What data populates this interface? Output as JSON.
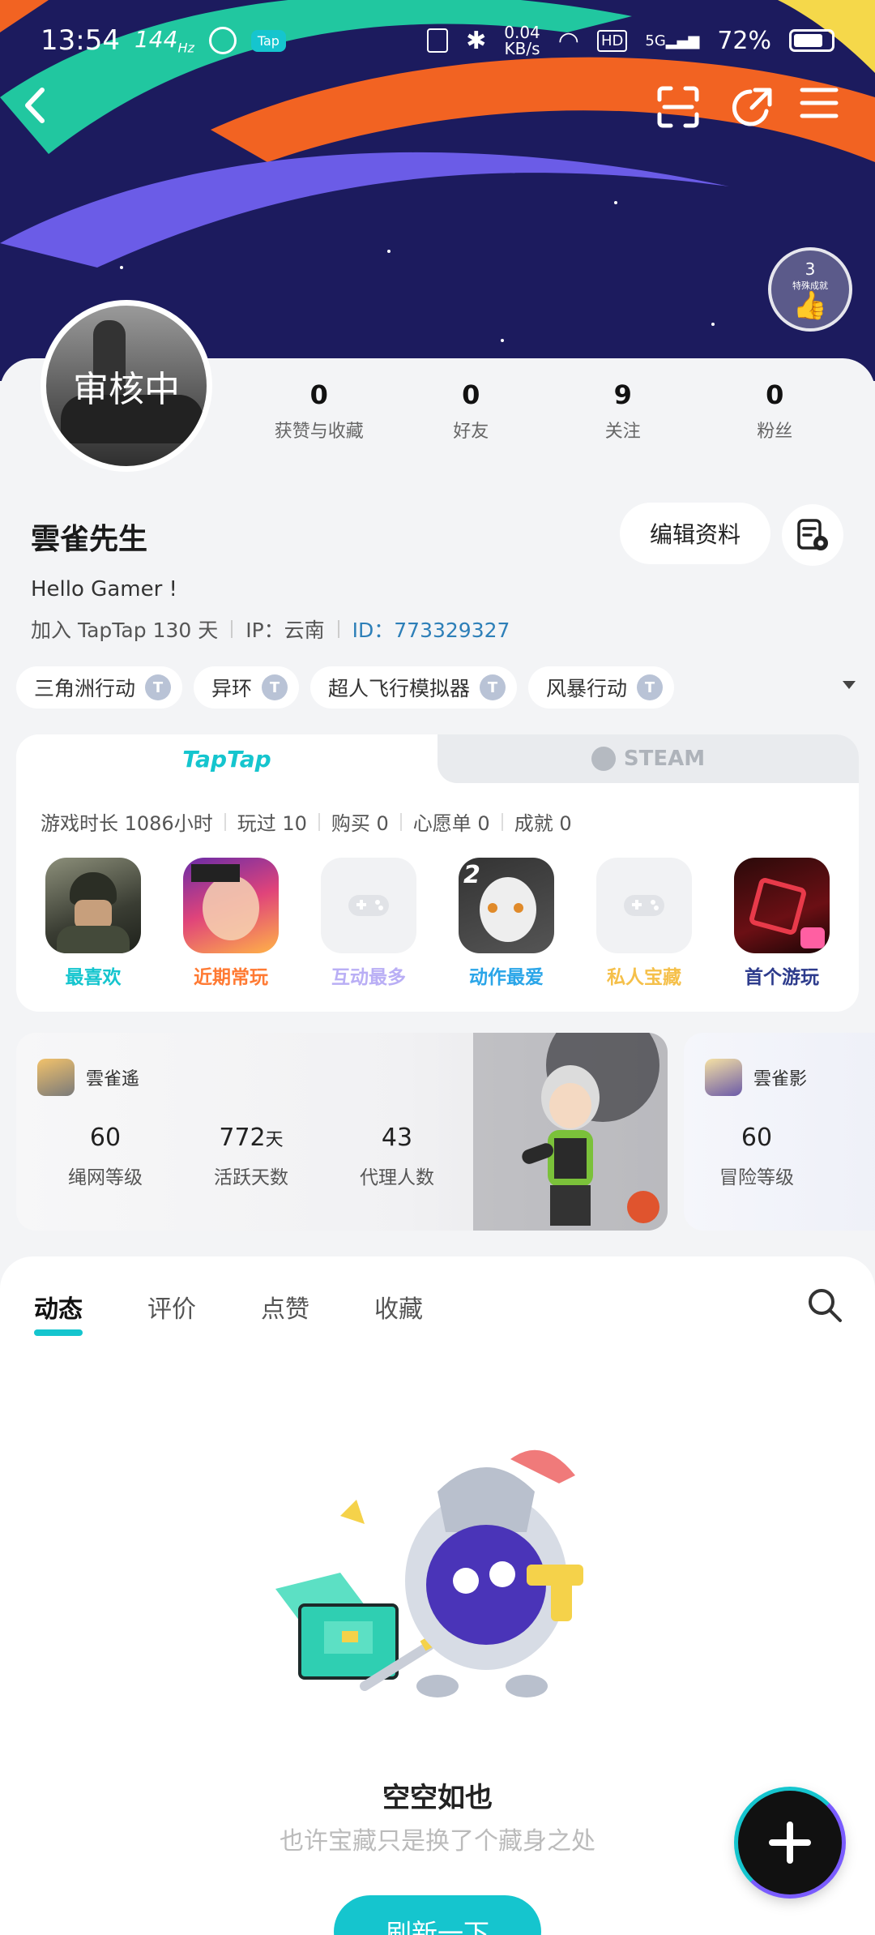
{
  "status_bar": {
    "time": "13:54",
    "refresh_rate": "144",
    "refresh_unit": "Hz",
    "app_badge": "Tap",
    "net_speed": "0.04",
    "net_unit": "KB/s",
    "hd": "HD",
    "signal": "5G",
    "battery": "72%"
  },
  "medal": {
    "count": "3",
    "label": "特殊成就"
  },
  "profile": {
    "avatar_text": "审核中",
    "stats": [
      {
        "value": "0",
        "label": "获赞与收藏"
      },
      {
        "value": "0",
        "label": "好友"
      },
      {
        "value": "9",
        "label": "关注"
      },
      {
        "value": "0",
        "label": "粉丝"
      }
    ],
    "username": "雲雀先生",
    "edit_label": "编辑资料",
    "bio": "Hello Gamer !",
    "joined": "加入 TapTap 130 天",
    "ip": "IP：云南",
    "id_label": "ID：",
    "id_value": "773329327",
    "tags": [
      "三角洲行动",
      "异环",
      "超人飞行模拟器",
      "风暴行动"
    ]
  },
  "games_card": {
    "tabs": {
      "taptap": "TapTap",
      "steam": "STEAM"
    },
    "info": [
      "游戏时长 1086小时",
      "玩过 10",
      "购买 0",
      "心愿单 0",
      "成就 0"
    ],
    "items": [
      {
        "label": "最喜欢",
        "color": "#15c5ce"
      },
      {
        "label": "近期常玩",
        "color": "#ff7a33"
      },
      {
        "label": "互动最多",
        "color": "#b9aef5"
      },
      {
        "label": "动作最爱",
        "color": "#2aa5e8"
      },
      {
        "label": "私人宝藏",
        "color": "#f5c04a"
      },
      {
        "label": "首个游玩",
        "color": "#2d3b8c"
      }
    ]
  },
  "char_cards": [
    {
      "name": "雲雀遙",
      "stats": [
        {
          "value": "60",
          "unit": "",
          "label": "绳网等级"
        },
        {
          "value": "772",
          "unit": "天",
          "label": "活跃天数"
        },
        {
          "value": "43",
          "unit": "",
          "label": "代理人数"
        }
      ]
    },
    {
      "name": "雲雀影",
      "stats": [
        {
          "value": "60",
          "unit": "",
          "label": "冒险等级"
        }
      ]
    }
  ],
  "feed": {
    "tabs": [
      "动态",
      "评价",
      "点赞",
      "收藏"
    ],
    "empty_title": "空空如也",
    "empty_sub": "也许宝藏只是换了个藏身之处",
    "refresh_label": "刷新一下"
  }
}
